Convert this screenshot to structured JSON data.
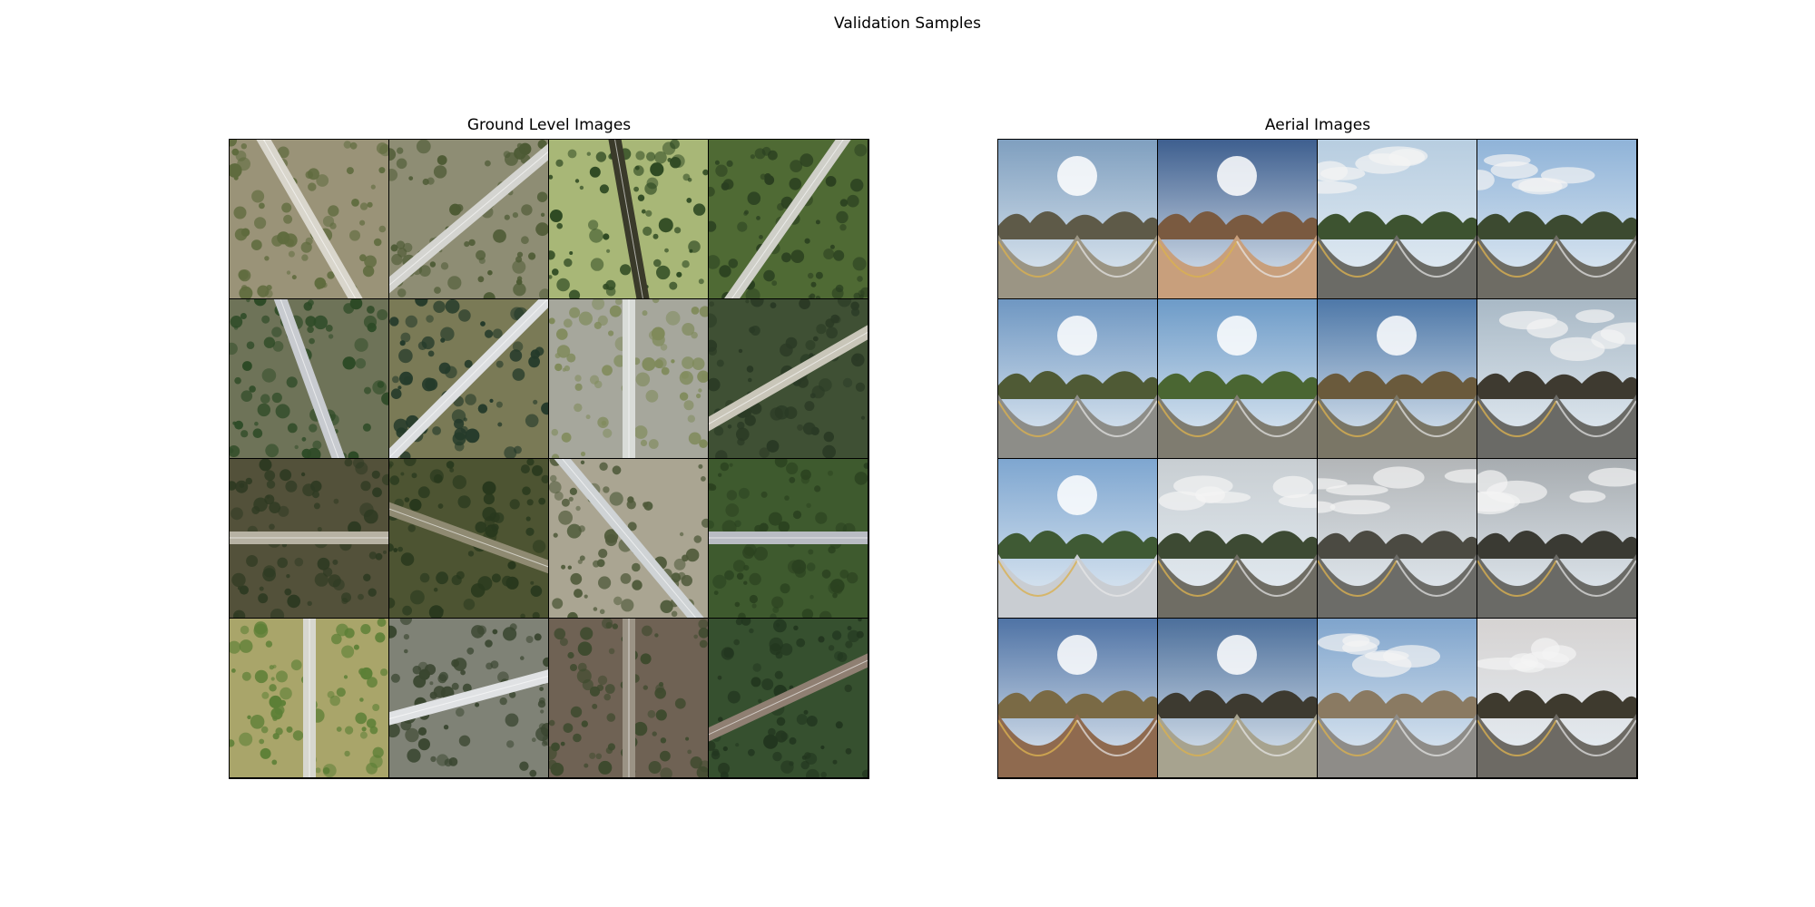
{
  "figure": {
    "suptitle": "Validation Samples"
  },
  "panels": [
    {
      "title": "Ground Level Images",
      "tiles": [
        {
          "kind": "aerial",
          "bg": "#9a9378",
          "road": "#d9d6cc",
          "angle": 60,
          "veg": "#5f6b3e"
        },
        {
          "kind": "aerial",
          "bg": "#8e8d74",
          "road": "#d4d4d0",
          "angle": -40,
          "veg": "#4d5a34"
        },
        {
          "kind": "aerial",
          "bg": "#a8b777",
          "road": "#3a3a2a",
          "angle": 80,
          "veg": "#2f4a23"
        },
        {
          "kind": "aerial",
          "bg": "#4f6a34",
          "road": "#cfcfc8",
          "angle": -55,
          "veg": "#2a3f20"
        },
        {
          "kind": "aerial",
          "bg": "#6e7358",
          "road": "#c8cbd0",
          "angle": 70,
          "veg": "#2d4a26"
        },
        {
          "kind": "aerial",
          "bg": "#7a7a56",
          "road": "#dcdee0",
          "angle": -45,
          "veg": "#243a2a"
        },
        {
          "kind": "aerial",
          "bg": "#a6a79c",
          "road": "#d9dcd8",
          "angle": 90,
          "veg": "#7f8a5a"
        },
        {
          "kind": "aerial",
          "bg": "#3f5034",
          "road": "#c9c6b9",
          "angle": -30,
          "veg": "#2a3a25"
        },
        {
          "kind": "aerial",
          "bg": "#53513a",
          "road": "#b7b2a3",
          "angle": 0,
          "veg": "#2e3a22"
        },
        {
          "kind": "aerial",
          "bg": "#4d5432",
          "road": "#8f8a72",
          "angle": 20,
          "veg": "#28381d"
        },
        {
          "kind": "aerial",
          "bg": "#aaa592",
          "road": "#cfd3d5",
          "angle": 50,
          "veg": "#4f5a3a"
        },
        {
          "kind": "aerial",
          "bg": "#3e5a2e",
          "road": "#b9bcc3",
          "angle": 0,
          "veg": "#2b4220"
        },
        {
          "kind": "aerial",
          "bg": "#a9a56a",
          "road": "#d7d7cf",
          "angle": 90,
          "veg": "#5c7f36"
        },
        {
          "kind": "aerial",
          "bg": "#7f8276",
          "road": "#e0e2e4",
          "angle": -15,
          "veg": "#3a4630"
        },
        {
          "kind": "aerial",
          "bg": "#6f6254",
          "road": "#9b9385",
          "angle": 90,
          "veg": "#3e4a2e"
        },
        {
          "kind": "aerial",
          "bg": "#36502f",
          "road": "#8f7f72",
          "angle": -25,
          "veg": "#22361f"
        }
      ]
    },
    {
      "title": "Aerial Images",
      "tiles": [
        {
          "kind": "pano",
          "sky": "#7f9fbf",
          "horizon": "#5e5a48",
          "ground": "#9b9584",
          "sun": true
        },
        {
          "kind": "pano",
          "sky": "#3e5f8f",
          "horizon": "#7a5a40",
          "ground": "#c89f7c",
          "sun": true
        },
        {
          "kind": "pano",
          "sky": "#b7cde0",
          "horizon": "#3d5330",
          "ground": "#6b6b66",
          "sun": false
        },
        {
          "kind": "pano",
          "sky": "#8fb3d8",
          "horizon": "#3c4a30",
          "ground": "#6e6c64",
          "sun": false
        },
        {
          "kind": "pano",
          "sky": "#6f97c2",
          "horizon": "#4f5a35",
          "ground": "#8d8d88",
          "sun": true
        },
        {
          "kind": "pano",
          "sky": "#6d9bc8",
          "horizon": "#4a6632",
          "ground": "#7f7c70",
          "sun": true
        },
        {
          "kind": "pano",
          "sky": "#4e78a8",
          "horizon": "#6a5a3c",
          "ground": "#7a7666",
          "sun": true
        },
        {
          "kind": "pano",
          "sky": "#a9b9c6",
          "horizon": "#3e3a30",
          "ground": "#6a6a66",
          "sun": false
        },
        {
          "kind": "pano",
          "sky": "#7ea6d0",
          "horizon": "#3f5a34",
          "ground": "#c9cdd2",
          "sun": true
        },
        {
          "kind": "pano",
          "sky": "#c8ced2",
          "horizon": "#3d4a33",
          "ground": "#6f6d64",
          "sun": false
        },
        {
          "kind": "pano",
          "sky": "#b3b6b8",
          "horizon": "#4b4a42",
          "ground": "#6c6c68",
          "sun": false
        },
        {
          "kind": "pano",
          "sky": "#a7acb0",
          "horizon": "#3a3a33",
          "ground": "#6a6a66",
          "sun": false
        },
        {
          "kind": "pano",
          "sky": "#4f73a5",
          "horizon": "#7a6a45",
          "ground": "#8f6a4f",
          "sun": true
        },
        {
          "kind": "pano",
          "sky": "#4c6f9b",
          "horizon": "#3d3a30",
          "ground": "#a7a38f",
          "sun": true
        },
        {
          "kind": "pano",
          "sky": "#7fa4cc",
          "horizon": "#8a7a62",
          "ground": "#8e8c88",
          "sun": false
        },
        {
          "kind": "pano",
          "sky": "#d6d3d2",
          "horizon": "#3e3a2e",
          "ground": "#6d6a64",
          "sun": false
        }
      ]
    }
  ]
}
